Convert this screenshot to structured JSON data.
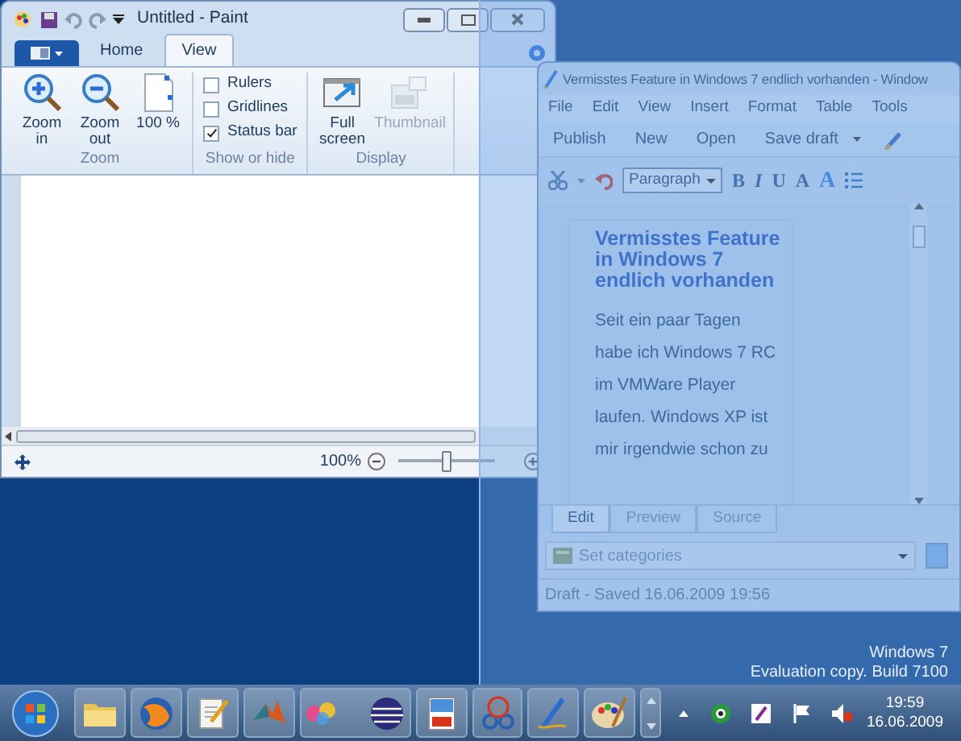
{
  "paint": {
    "title": "Untitled - Paint",
    "tabs": [
      {
        "label": "Home",
        "selected": false
      },
      {
        "label": "View",
        "selected": true
      }
    ],
    "groups": [
      {
        "kind": "buttons",
        "label": "Zoom",
        "items": [
          {
            "label": "Zoom in",
            "disabled": false
          },
          {
            "label": "Zoom out",
            "disabled": false
          },
          {
            "label": "100 %",
            "disabled": false
          }
        ]
      },
      {
        "kind": "checkboxes",
        "label": "Show or hide",
        "items": [
          {
            "label": "Rulers",
            "checked": false
          },
          {
            "label": "Gridlines",
            "checked": false
          },
          {
            "label": "Status bar",
            "checked": true
          }
        ]
      },
      {
        "kind": "buttons",
        "label": "Display",
        "items": [
          {
            "label": "Full screen",
            "disabled": false
          },
          {
            "label": "Thumbnail",
            "disabled": true
          }
        ]
      }
    ],
    "status": {
      "zoom": "100%",
      "level": 0.5
    }
  },
  "writer": {
    "title": "Vermisstes Feature in Windows 7 endlich vorhanden - Window",
    "menu": [
      "File",
      "Edit",
      "View",
      "Insert",
      "Format",
      "Table",
      "Tools"
    ],
    "toolbar": [
      "Publish",
      "New",
      "Open",
      "Save draft"
    ],
    "style": "Paragraph",
    "format_buttons": [
      "B",
      "I",
      "U",
      "A",
      "A"
    ],
    "post_title": "Vermisstes Feature in Windows 7 endlich vorhanden",
    "post_lines": [
      "Seit ein paar Tagen",
      "habe ich Windows 7 RC",
      "im VMWare Player",
      "laufen. Windows XP ist",
      "mir irgendwie schon zu"
    ],
    "tabs": [
      {
        "label": "Edit",
        "selected": true
      },
      {
        "label": "Preview",
        "selected": false
      },
      {
        "label": "Source",
        "selected": false
      }
    ],
    "categories": "Set categories",
    "status": "Draft - Saved 16.06.2009 19:56"
  },
  "desktop": {
    "edition": "Windows 7",
    "build": "Evaluation copy. Build 7100"
  },
  "taskbar": {
    "time": "19:59",
    "date": "16.06.2009"
  }
}
